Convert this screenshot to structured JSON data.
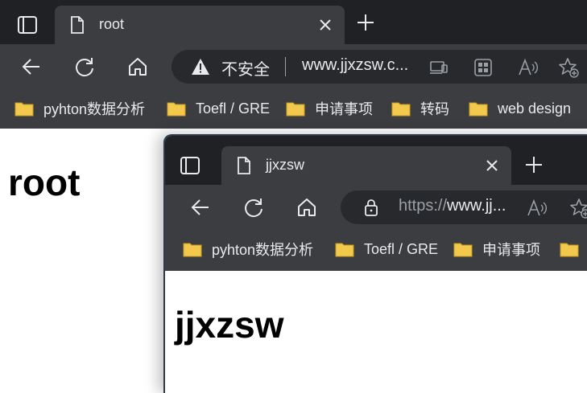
{
  "back_window": {
    "tab": {
      "title": "root"
    },
    "address": {
      "security_label": "不安全",
      "url": "www.jjxzsw.c..."
    },
    "bookmarks": [
      "pyhton数据分析",
      "Toefl / GRE",
      "申请事项",
      "转码",
      "web design"
    ],
    "content": {
      "heading": "root"
    }
  },
  "front_window": {
    "tab": {
      "title": "jjxzsw"
    },
    "address": {
      "url_prefix": "https://",
      "url_host": "www.jj..."
    },
    "bookmarks": [
      "pyhton数据分析",
      "Toefl / GRE",
      "申请事项"
    ],
    "content": {
      "heading": "jjxzsw"
    }
  },
  "colors": {
    "tabbar": "#202124",
    "toolbar": "#3c3d41",
    "folder": "#f2c94c"
  }
}
